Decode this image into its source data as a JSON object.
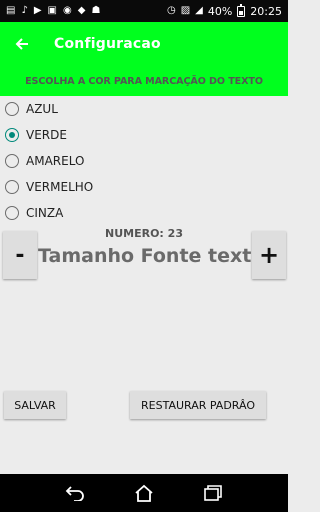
{
  "status_bar": {
    "battery": "40%",
    "time": "20:25",
    "icons": [
      "sms-icon",
      "music-icon",
      "video-icon",
      "image-icon",
      "messenger-icon",
      "shield-icon",
      "android-icon",
      "alarm-icon",
      "signal-off-icon",
      "cellular-signal-icon"
    ]
  },
  "app_bar": {
    "title": "Configuracao"
  },
  "banner": {
    "text": "ESCOLHA A COR PARA MARCAÇÃO DO TEXTO"
  },
  "colors": {
    "options": [
      "AZUL",
      "VERDE",
      "AMARELO",
      "VERMELHO",
      "CINZA"
    ],
    "selected": "VERDE",
    "accent": "#00897b",
    "bar": "#00ff1e"
  },
  "font": {
    "numero_label": "NUMERO: 23",
    "value": 23,
    "label": "Tamanho Fonte texto",
    "minus": "-",
    "plus": "+"
  },
  "buttons": {
    "save": "SALVAR",
    "restore": "RESTAURAR PADRÂO"
  }
}
